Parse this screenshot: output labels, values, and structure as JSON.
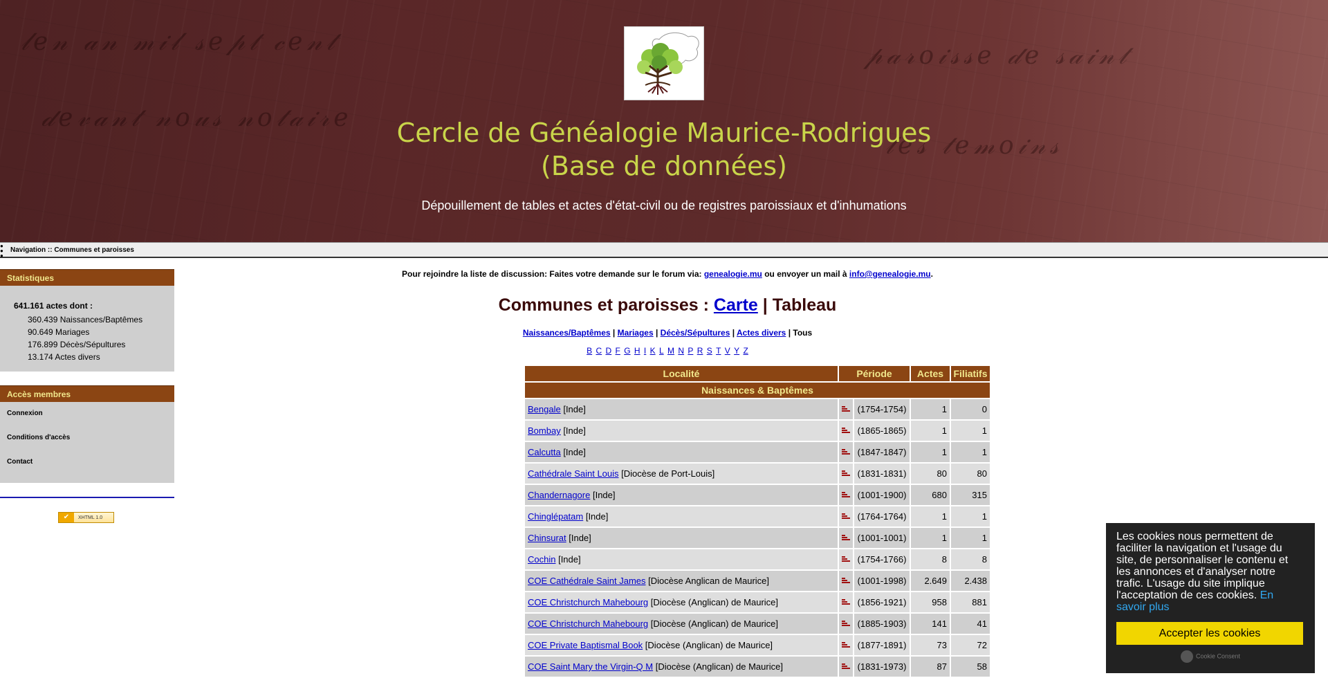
{
  "header": {
    "title_line1": "Cercle de Généalogie Maurice-Rodrigues",
    "title_line2": "(Base de données)",
    "subtitle": "Dépouillement de tables et actes d'état-civil ou de registres paroissiaux et d'inhumations"
  },
  "breadcrumb": {
    "text": "Navigation :: Communes et paroisses"
  },
  "sidebar": {
    "stats_title": "Statistiques",
    "total": "641.161 actes dont :",
    "lines": [
      "360.439 Naissances/Baptêmes",
      "90.649 Mariages",
      "176.899 Décès/Sépultures",
      "13.174 Actes divers"
    ],
    "members_title": "Accès membres",
    "links": [
      "Connexion",
      "Conditions d'accès",
      "Contact"
    ],
    "badge": "XHTML 1.0"
  },
  "main": {
    "notice_pre": "Pour rejoindre la liste de discussion: Faites votre demande sur le forum via: ",
    "notice_link1": "genealogie.mu",
    "notice_mid": " ou envoyer un mail à ",
    "notice_link2": "info@genealogie.mu",
    "notice_post": ".",
    "title_pre": "Communes et paroisses : ",
    "title_link": "Carte",
    "title_post": " | Tableau",
    "filters": {
      "naissances": "Naissances/Baptêmes",
      "mariages": "Mariages",
      "deces": "Décès/Sépultures",
      "divers": "Actes divers",
      "tous": "Tous"
    },
    "letters": [
      "B",
      "C",
      "D",
      "F",
      "G",
      "H",
      "I",
      "K",
      "L",
      "M",
      "N",
      "P",
      "R",
      "S",
      "T",
      "V",
      "Y",
      "Z"
    ]
  },
  "table": {
    "headers": {
      "localite": "Localité",
      "periode": "Période",
      "actes": "Actes",
      "filiatifs": "Filiatifs"
    },
    "section": "Naissances & Baptêmes",
    "rows": [
      {
        "name": "Bengale",
        "extra": " [Inde]",
        "period": "(1754-1754)",
        "actes": "1",
        "filiatifs": "0"
      },
      {
        "name": "Bombay",
        "extra": " [Inde]",
        "period": "(1865-1865)",
        "actes": "1",
        "filiatifs": "1"
      },
      {
        "name": "Calcutta",
        "extra": " [Inde]",
        "period": "(1847-1847)",
        "actes": "1",
        "filiatifs": "1"
      },
      {
        "name": "Cathédrale Saint Louis",
        "extra": " [Diocèse de Port-Louis]",
        "period": "(1831-1831)",
        "actes": "80",
        "filiatifs": "80"
      },
      {
        "name": "Chandernagore",
        "extra": " [Inde]",
        "period": "(1001-1900)",
        "actes": "680",
        "filiatifs": "315"
      },
      {
        "name": "Chinglépatam",
        "extra": " [Inde]",
        "period": "(1764-1764)",
        "actes": "1",
        "filiatifs": "1"
      },
      {
        "name": "Chinsurat",
        "extra": " [Inde]",
        "period": "(1001-1001)",
        "actes": "1",
        "filiatifs": "1"
      },
      {
        "name": "Cochin",
        "extra": " [Inde]",
        "period": "(1754-1766)",
        "actes": "8",
        "filiatifs": "8"
      },
      {
        "name": "COE Cathédrale Saint James",
        "extra": " [Diocèse Anglican de Maurice]",
        "period": "(1001-1998)",
        "actes": "2.649",
        "filiatifs": "2.438"
      },
      {
        "name": "COE Christchurch Mahebourg",
        "extra": " [Diocèse (Anglican) de Maurice]",
        "period": "(1856-1921)",
        "actes": "958",
        "filiatifs": "881"
      },
      {
        "name": "COE Christchurch Mahebourg",
        "extra": " [Diocèse (Anglican) de Maurice]",
        "period": "(1885-1903)",
        "actes": "141",
        "filiatifs": "41"
      },
      {
        "name": "COE Private Baptismal Book",
        "extra": " [Diocèse (Anglican) de Maurice]",
        "period": "(1877-1891)",
        "actes": "73",
        "filiatifs": "72"
      },
      {
        "name": "COE Saint Mary the Virgin-Q M",
        "extra": " [Diocèse (Anglican) de Maurice]",
        "period": "(1831-1973)",
        "actes": "87",
        "filiatifs": "58"
      }
    ]
  },
  "cookie": {
    "message": "Les cookies nous permettent de faciliter la navigation et l'usage du site, de personnaliser le contenu et les annonces et d'analyser notre trafic. L'usage du site implique l'acceptation de ces cookies. ",
    "more_link": "En savoir plus",
    "accept_button": "Accepter les cookies",
    "credit": "Cookie Consent"
  }
}
